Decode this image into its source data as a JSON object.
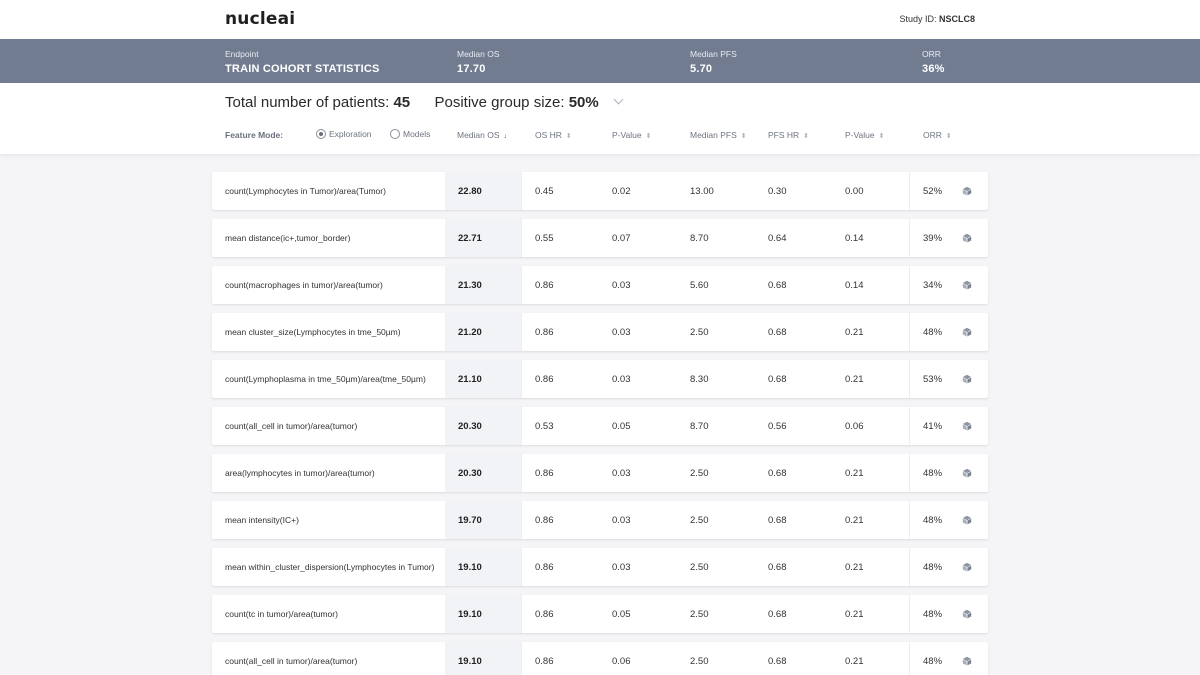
{
  "app": {
    "logo": "nucleai",
    "study_label": "Study ID:",
    "study_id": "NSCLC8"
  },
  "stats": {
    "endpoint_label": "Endpoint",
    "endpoint_value": "TRAIN COHORT STATISTICS",
    "median_os_label": "Median OS",
    "median_os_value": "17.70",
    "median_pfs_label": "Median PFS",
    "median_pfs_value": "5.70",
    "orr_label": "ORR",
    "orr_value": "36%"
  },
  "summary": {
    "total_label": "Total number of patients:",
    "total_value": "45",
    "group_label": "Positive group size:",
    "group_value": "50%"
  },
  "feature_mode": {
    "label": "Feature Mode:",
    "options": [
      "Exploration",
      "Models"
    ],
    "selected": "Exploration"
  },
  "columns": {
    "median_os": "Median OS",
    "os_hr": "OS HR",
    "p_value_1": "P-Value",
    "median_pfs": "Median PFS",
    "pfs_hr": "PFS HR",
    "p_value_2": "P-Value",
    "orr": "ORR"
  },
  "rows": [
    {
      "name": "count(Lymphocytes in Tumor)/area(Tumor)",
      "median_os": "22.80",
      "os_hr": "0.45",
      "p1": "0.02",
      "median_pfs": "13.00",
      "pfs_hr": "0.30",
      "p2": "0.00",
      "orr": "52%"
    },
    {
      "name": "mean distance(ic+,tumor_border)",
      "median_os": "22.71",
      "os_hr": "0.55",
      "p1": "0.07",
      "median_pfs": "8.70",
      "pfs_hr": "0.64",
      "p2": "0.14",
      "orr": "39%"
    },
    {
      "name": "count(macrophages in tumor)/area(tumor)",
      "median_os": "21.30",
      "os_hr": "0.86",
      "p1": "0.03",
      "median_pfs": "5.60",
      "pfs_hr": "0.68",
      "p2": "0.14",
      "orr": "34%"
    },
    {
      "name": "mean cluster_size(Lymphocytes in tme_50µm)",
      "median_os": "21.20",
      "os_hr": "0.86",
      "p1": "0.03",
      "median_pfs": "2.50",
      "pfs_hr": "0.68",
      "p2": "0.21",
      "orr": "48%"
    },
    {
      "name": "count(Lymphoplasma in tme_50µm)/area(tme_50µm)",
      "median_os": "21.10",
      "os_hr": "0.86",
      "p1": "0.03",
      "median_pfs": "8.30",
      "pfs_hr": "0.68",
      "p2": "0.21",
      "orr": "53%"
    },
    {
      "name": "count(all_cell in tumor)/area(tumor)",
      "median_os": "20.30",
      "os_hr": "0.53",
      "p1": "0.05",
      "median_pfs": "8.70",
      "pfs_hr": "0.56",
      "p2": "0.06",
      "orr": "41%"
    },
    {
      "name": "area(lymphocytes in tumor)/area(tumor)",
      "median_os": "20.30",
      "os_hr": "0.86",
      "p1": "0.03",
      "median_pfs": "2.50",
      "pfs_hr": "0.68",
      "p2": "0.21",
      "orr": "48%"
    },
    {
      "name": "mean intensity(IC+)",
      "median_os": "19.70",
      "os_hr": "0.86",
      "p1": "0.03",
      "median_pfs": "2.50",
      "pfs_hr": "0.68",
      "p2": "0.21",
      "orr": "48%"
    },
    {
      "name": "mean within_cluster_dispersion(Lymphocytes in Tumor)",
      "median_os": "19.10",
      "os_hr": "0.86",
      "p1": "0.03",
      "median_pfs": "2.50",
      "pfs_hr": "0.68",
      "p2": "0.21",
      "orr": "48%"
    },
    {
      "name": "count(tc in tumor)/area(tumor)",
      "median_os": "19.10",
      "os_hr": "0.86",
      "p1": "0.05",
      "median_pfs": "2.50",
      "pfs_hr": "0.68",
      "p2": "0.21",
      "orr": "48%"
    },
    {
      "name": "count(all_cell in tumor)/area(tumor)",
      "median_os": "19.10",
      "os_hr": "0.86",
      "p1": "0.06",
      "median_pfs": "2.50",
      "pfs_hr": "0.68",
      "p2": "0.21",
      "orr": "48%"
    }
  ],
  "icons": {
    "row_action": "cube-icon",
    "sort": "sort-arrows-icon",
    "dropdown": "chevron-down-icon"
  }
}
